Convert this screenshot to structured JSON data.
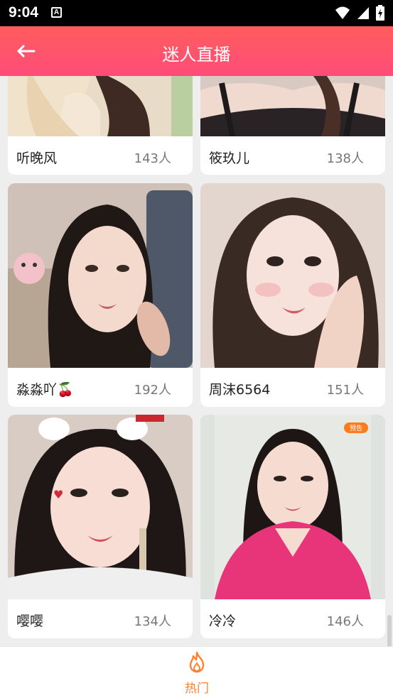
{
  "status_bar": {
    "time": "9:04",
    "app_icon_letter": "A"
  },
  "header": {
    "title": "迷人直播",
    "back_icon": "arrow-left-icon"
  },
  "streams": [
    {
      "name": "听晚风",
      "viewers": "143人"
    },
    {
      "name": "筱玖儿",
      "viewers": "138人"
    },
    {
      "name": "淼淼吖🍒",
      "viewers": "192人"
    },
    {
      "name": "周沫6564",
      "viewers": "151人"
    },
    {
      "name": "嘤嘤",
      "viewers": "134人"
    },
    {
      "name": "冷冷",
      "viewers": "146人",
      "badge": "预告"
    }
  ],
  "bottom_nav": {
    "hot_label": "热门",
    "hot_icon": "flame-icon"
  },
  "colors": {
    "header_start": "#ff5d5d",
    "header_end": "#ff4c79",
    "accent": "#ff8030"
  }
}
